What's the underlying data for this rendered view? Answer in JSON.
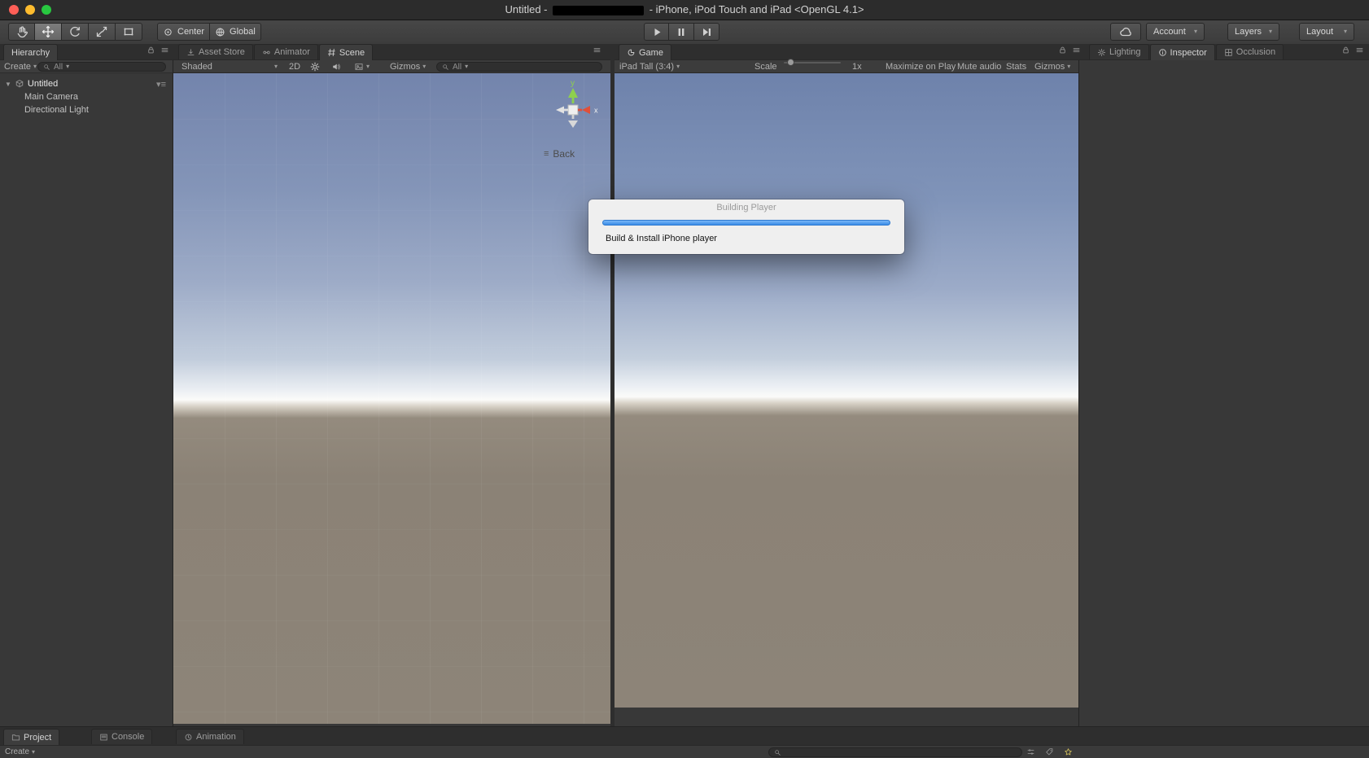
{
  "colors": {
    "progress_blue": "#3a8ce6",
    "axis_green": "#8ed04e",
    "axis_red": "#e0503a"
  },
  "titlebar": {
    "title_prefix": "Untitled - ",
    "title_suffix": " - iPhone, iPod Touch and iPad <OpenGL 4.1>"
  },
  "toolbar": {
    "pivot": "Center",
    "space": "Global",
    "account": "Account",
    "layers": "Layers",
    "layout": "Layout"
  },
  "hierarchy": {
    "tab": "Hierarchy",
    "create": "Create",
    "search": "All",
    "items": [
      {
        "label": "Untitled"
      },
      {
        "label": "Main Camera"
      },
      {
        "label": "Directional Light"
      }
    ]
  },
  "scene": {
    "tabs": {
      "asset_store": "Asset Store",
      "animator": "Animator",
      "scene": "Scene"
    },
    "toolbar": {
      "shaded": "Shaded",
      "mode2d": "2D",
      "gizmos": "Gizmos",
      "search": "All"
    },
    "gizmo": {
      "y": "y",
      "x": "x",
      "back": "Back"
    }
  },
  "game": {
    "tab": "Game",
    "toolbar": {
      "aspect": "iPad Tall (3:4)",
      "scale": "Scale",
      "scale_value": "1x",
      "maximize": "Maximize on Play",
      "mute": "Mute audio",
      "stats": "Stats",
      "gizmos": "Gizmos"
    }
  },
  "inspector": {
    "tabs": {
      "lighting": "Lighting",
      "inspector": "Inspector",
      "occlusion": "Occlusion"
    }
  },
  "bottom": {
    "tabs": {
      "project": "Project",
      "console": "Console",
      "animation": "Animation"
    },
    "create": "Create"
  },
  "dialog": {
    "title": "Building Player",
    "status": "Build & Install iPhone player"
  }
}
